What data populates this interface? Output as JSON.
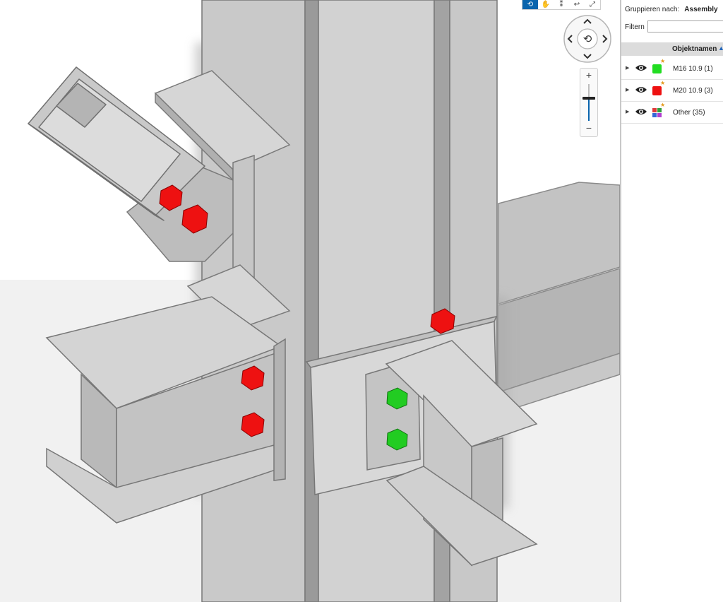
{
  "toolbar": {
    "buttons": [
      {
        "name": "orbit-tool-icon",
        "glyph": "⟲",
        "active": true
      },
      {
        "name": "pan-tool-icon",
        "glyph": "✋",
        "active": false
      },
      {
        "name": "walk-tool-icon",
        "glyph": "⁑",
        "active": false
      },
      {
        "name": "undo-view-icon",
        "glyph": "↩",
        "active": false
      },
      {
        "name": "fullscreen-icon",
        "glyph": "⤢",
        "active": false
      }
    ]
  },
  "navcube": {
    "center_glyph": "⟲"
  },
  "zoom": {
    "plus": "+",
    "minus": "−",
    "level": 0.62
  },
  "panel": {
    "group_label": "Gruppieren nach:",
    "group_value": "Assembly",
    "filter_label": "Filtern",
    "filter_value": "",
    "column_header": "Objektnamen",
    "rows": [
      {
        "label": "M16 10.9 (1)",
        "color": "#22dd22",
        "starred": true
      },
      {
        "label": "M20 10.9 (3)",
        "color": "#ee1111",
        "starred": true
      },
      {
        "label": "Other (35)",
        "colors": [
          "#e03a3a",
          "#2f9e3a",
          "#3568d6",
          "#b13fd0"
        ],
        "starred": true
      }
    ]
  },
  "colors": {
    "steel": "#cfcfcf",
    "bolt_m20": "#ee1111",
    "bolt_m16": "#22cc22",
    "accent": "#0a64ad"
  }
}
